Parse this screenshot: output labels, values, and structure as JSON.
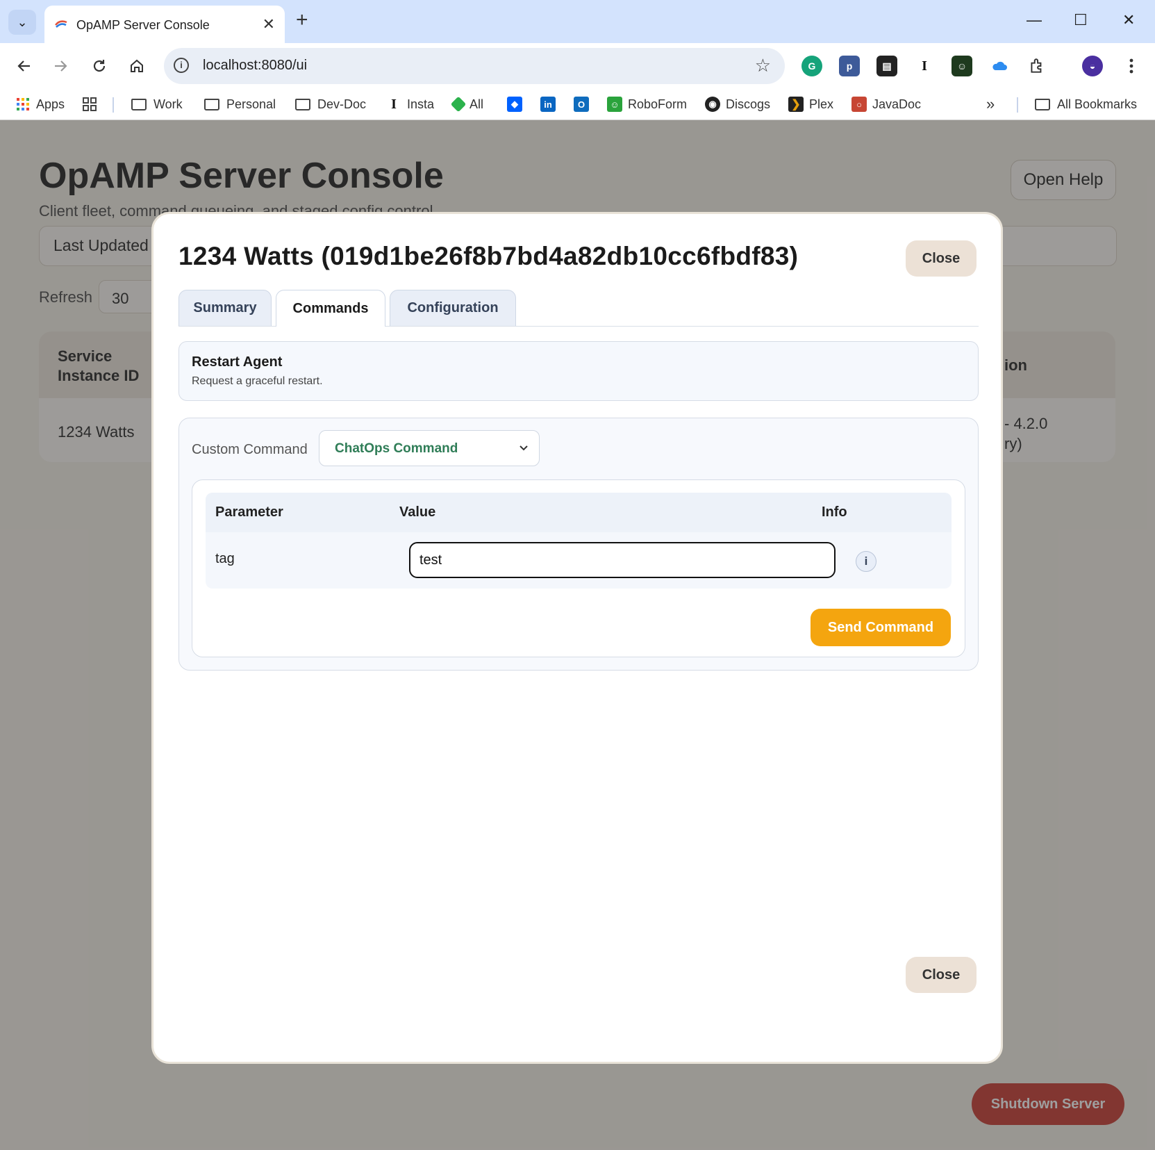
{
  "browser": {
    "tab_title": "OpAMP Server Console",
    "new_tab_symbol": "+",
    "tab_close_symbol": "✕",
    "url": "localhost:8080/ui",
    "window_controls": {
      "minimize": "—",
      "maximize": "☐",
      "close": "✕"
    },
    "bookmarks": [
      {
        "label": "Apps",
        "icon": "apps-grid-icon"
      },
      {
        "label": "",
        "icon": "tab-groups-icon"
      },
      {
        "label": "Work",
        "icon": "folder-icon"
      },
      {
        "label": "Personal",
        "icon": "folder-icon"
      },
      {
        "label": "Dev-Doc",
        "icon": "folder-icon"
      },
      {
        "label": "Insta",
        "icon": "instapaper-icon"
      },
      {
        "label": "All",
        "icon": "feedly-icon"
      },
      {
        "label": "",
        "icon": "dropbox-icon"
      },
      {
        "label": "",
        "icon": "linkedin-icon"
      },
      {
        "label": "",
        "icon": "outlook-icon"
      },
      {
        "label": "RoboForm",
        "icon": "roboform-icon"
      },
      {
        "label": "Discogs",
        "icon": "discogs-icon"
      },
      {
        "label": "Plex",
        "icon": "plex-icon"
      },
      {
        "label": "JavaDoc",
        "icon": "oracle-icon"
      }
    ],
    "more_bookmarks": "»",
    "all_bookmarks": "All Bookmarks"
  },
  "page": {
    "title": "OpAMP Server Console",
    "subtitle": "Client fleet, command queueing, and staged config control",
    "open_help": "Open Help",
    "last_updated": "Last Updated",
    "refresh_label": "Refresh",
    "refresh_value": "30",
    "grid": {
      "header_first": "Service Instance ID",
      "header_last": "ion",
      "row_first": "1234 Watts",
      "row_last_line1": "- 4.2.0",
      "row_last_line2": "ry)"
    },
    "shutdown_label": "Shutdown Server"
  },
  "modal": {
    "title": "1234 Watts (019d1be26f8b7bd4a82db10cc6fbdf83)",
    "close_label": "Close",
    "tabs": [
      {
        "label": "Summary",
        "active": false
      },
      {
        "label": "Commands",
        "active": true
      },
      {
        "label": "Configuration",
        "active": false
      }
    ],
    "restart": {
      "title": "Restart Agent",
      "description": "Request a graceful restart."
    },
    "custom_command": {
      "label": "Custom Command",
      "selected": "ChatOps Command"
    },
    "params_table": {
      "headers": [
        "Parameter",
        "Value",
        "Info"
      ],
      "rows": [
        {
          "parameter": "tag",
          "value": "test",
          "info": "i"
        }
      ]
    },
    "send_label": "Send Command"
  },
  "colors": {
    "accent_orange": "#f4a50f",
    "danger_red": "#c8372d",
    "select_green": "#2f7d57",
    "tab_strip_blue": "#d3e3fd"
  }
}
